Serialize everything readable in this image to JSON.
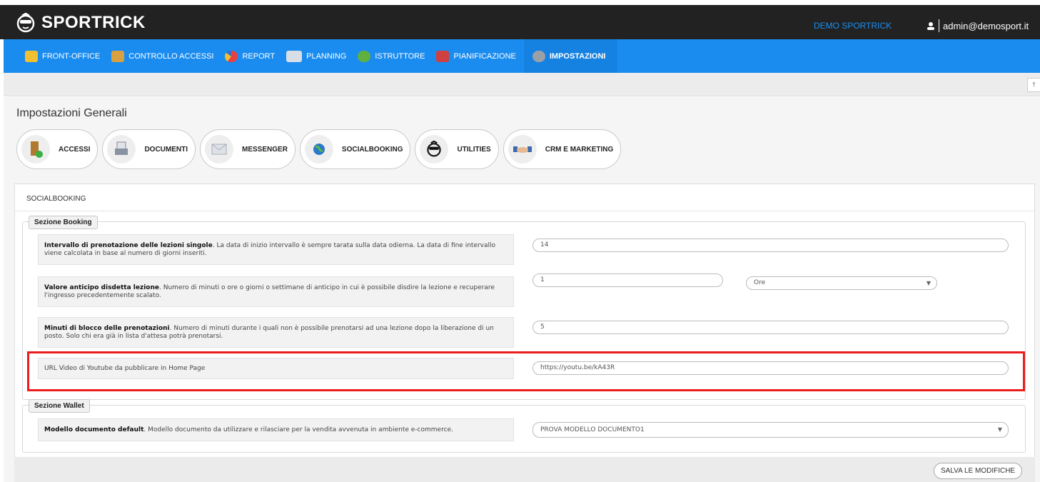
{
  "header": {
    "brand": "SPORTRICK",
    "company": "DEMO SPORTRICK",
    "user": "admin@demosport.it"
  },
  "nav": [
    {
      "label": "FRONT-OFFICE",
      "icon": "person-icon",
      "color": "#f0c030"
    },
    {
      "label": "CONTROLLO ACCESSI",
      "icon": "access-icon",
      "color": "#d8a040"
    },
    {
      "label": "REPORT",
      "icon": "pie-chart-icon",
      "color": "#e84040"
    },
    {
      "label": "PLANNING",
      "icon": "calendar-grid-icon",
      "color": "#d0d8e0"
    },
    {
      "label": "ISTRUTTORE",
      "icon": "instructors-icon",
      "color": "#60b040"
    },
    {
      "label": "PIANIFICAZIONE",
      "icon": "calendar-icon",
      "color": "#d04040"
    },
    {
      "label": "IMPOSTAZIONI",
      "icon": "gear-icon",
      "color": "#a0a0a0"
    }
  ],
  "page": {
    "title": "Impostazioni Generali"
  },
  "tabs": [
    {
      "label": "ACCESSI",
      "icon": "door-icon"
    },
    {
      "label": "DOCUMENTI",
      "icon": "printer-icon"
    },
    {
      "label": "MESSENGER",
      "icon": "envelope-icon"
    },
    {
      "label": "SOCIALBOOKING",
      "icon": "globe-icon"
    },
    {
      "label": "UTILITIES",
      "icon": "mascot-icon"
    },
    {
      "label": "CRM E MARKETING",
      "icon": "handshake-icon"
    }
  ],
  "panel": {
    "title": "SOCIALBOOKING"
  },
  "booking": {
    "legend": "Sezione Booking",
    "intervallo": {
      "bold": "Intervallo di prenotazione delle lezioni singole",
      "text": ". La data di inizio intervallo è sempre tarata sulla data odierna. La data di fine intervallo viene calcolata in base al numero di giorni inseriti.",
      "value": "14"
    },
    "anticipo": {
      "bold": "Valore anticipo disdetta lezione",
      "text": ". Numero di minuti o ore o giorni o settimane di anticipo in cui è possibile disdire la lezione e recuperare l'ingresso precedentemente scalato.",
      "value": "1",
      "unit": "Ore"
    },
    "blocco": {
      "bold": "Minuti di blocco delle prenotazioni",
      "text": ". Numero di minuti durante i quali non è possibile prenotarsi ad una lezione dopo la liberazione di un posto. Solo chi era già in lista d'attesa potrà prenotarsi.",
      "value": "5"
    },
    "youtube": {
      "text": "URL Video di Youtube da pubblicare in Home Page",
      "value": "https://youtu.be/kA43R"
    }
  },
  "wallet": {
    "legend": "Sezione Wallet",
    "modello": {
      "bold": "Modello documento default",
      "text": ". Modello documento da utilizzare e rilasciare per la vendita avvenuta in ambiente e-commerce.",
      "value": "PROVA MODELLO DOCUMENTO1"
    }
  },
  "save_label": "SALVA LE MODIFICHE",
  "pin_glyph": "†"
}
